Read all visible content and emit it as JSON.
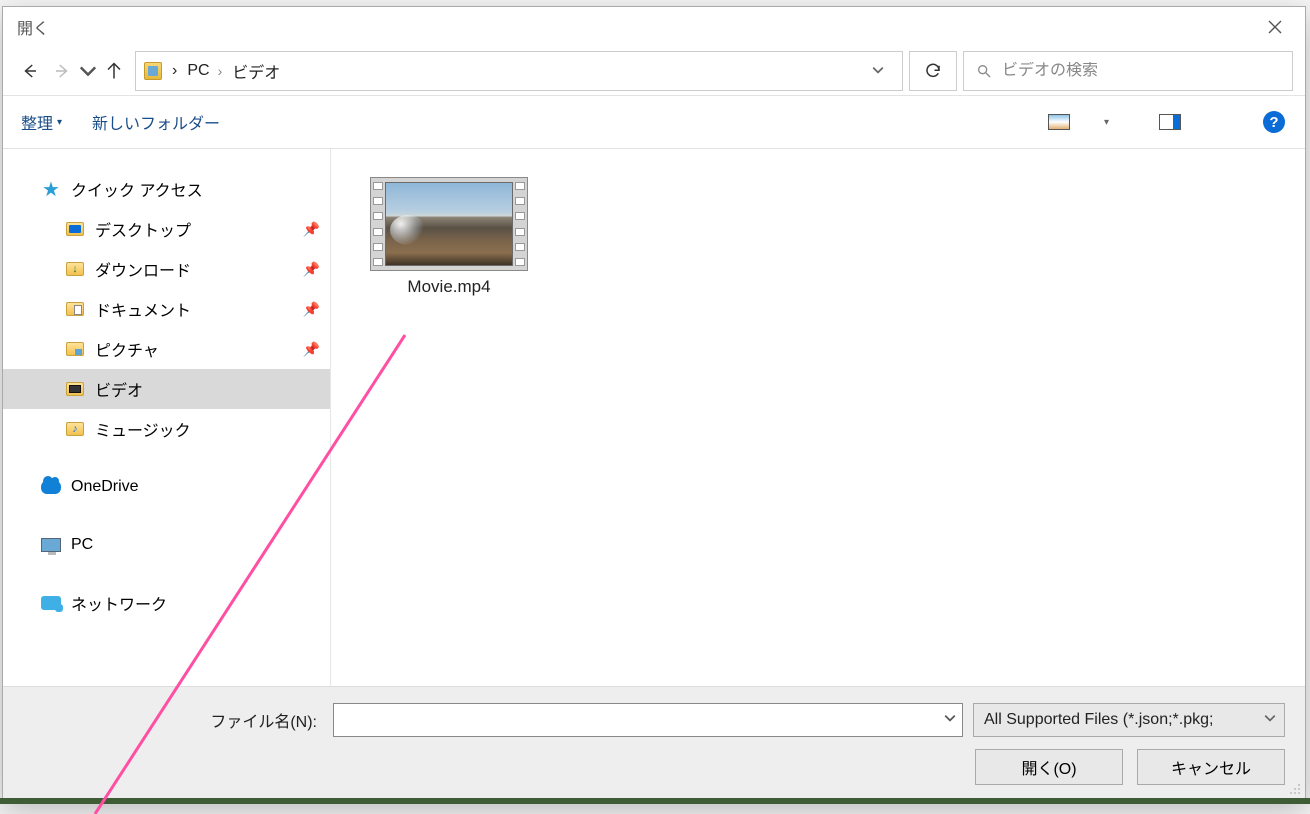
{
  "window": {
    "title": "開く"
  },
  "nav": {
    "breadcrumb": [
      "PC",
      "ビデオ"
    ],
    "search_placeholder": "ビデオの検索"
  },
  "toolbar": {
    "organize": "整理",
    "new_folder": "新しいフォルダー"
  },
  "sidebar": {
    "quick_access": "クイック アクセス",
    "desktop": "デスクトップ",
    "downloads": "ダウンロード",
    "documents": "ドキュメント",
    "pictures": "ピクチャ",
    "videos": "ビデオ",
    "music": "ミュージック",
    "onedrive": "OneDrive",
    "pc": "PC",
    "network": "ネットワーク"
  },
  "content": {
    "files": [
      {
        "name": "Movie.mp4"
      }
    ]
  },
  "footer": {
    "filename_label": "ファイル名(N):",
    "filename_value": "",
    "filetype": "All Supported Files (*.json;*.pkg;",
    "open": "開く(O)",
    "cancel": "キャンセル"
  }
}
